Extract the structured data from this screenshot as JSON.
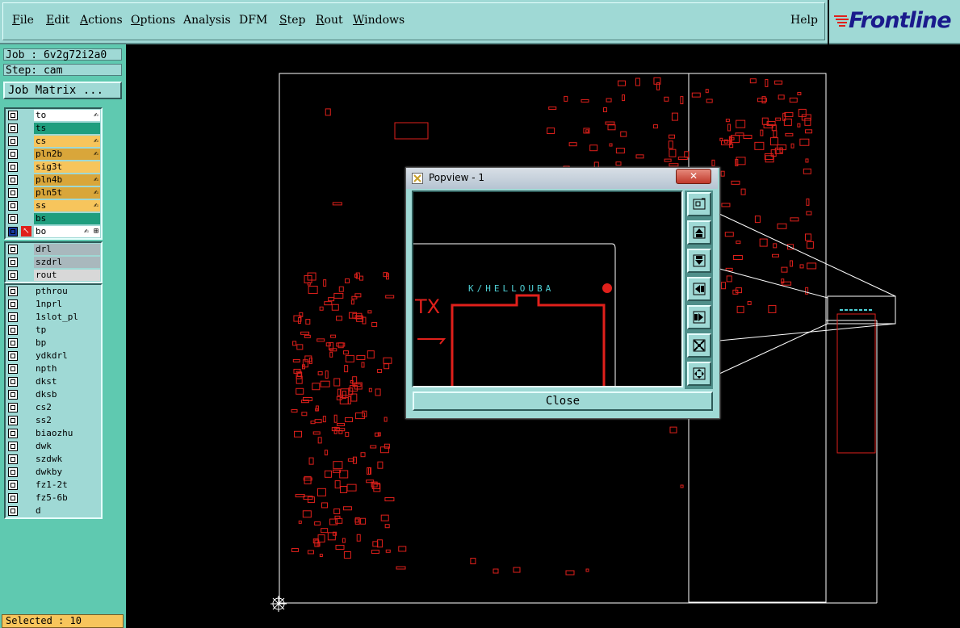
{
  "menu": {
    "items": [
      "File",
      "Edit",
      "Actions",
      "Options",
      "Analysis",
      "DFM",
      "Step",
      "Rout",
      "Windows"
    ],
    "help": "Help"
  },
  "logo": {
    "text": "Frontline"
  },
  "job": {
    "job_label": "Job : 6v2g72i2a0",
    "step_label": "Step: cam"
  },
  "job_matrix_label": "Job Matrix ...",
  "layers_board": [
    {
      "name": "to",
      "color": "#ffffff",
      "ind": "✍"
    },
    {
      "name": "ts",
      "color": "#1f9e7e",
      "ind": ""
    },
    {
      "name": "cs",
      "color": "#f7c55c",
      "ind": "✍"
    },
    {
      "name": "pln2b",
      "color": "#d9a63a",
      "ind": "✍"
    },
    {
      "name": "sig3t",
      "color": "#f7c55c",
      "ind": ""
    },
    {
      "name": "pln4b",
      "color": "#d9a63a",
      "ind": "✍"
    },
    {
      "name": "pln5t",
      "color": "#d9a63a",
      "ind": "✍"
    },
    {
      "name": "ss",
      "color": "#f7c55c",
      "ind": "✍"
    },
    {
      "name": "bs",
      "color": "#1f9e7e",
      "ind": ""
    },
    {
      "name": "bo",
      "color": "#ffffff",
      "ind": "✍ ⊞"
    }
  ],
  "layers_drill": [
    {
      "name": "drl",
      "color": "#a9b8bd"
    },
    {
      "name": "szdrl",
      "color": "#a9b8bd"
    },
    {
      "name": "rout",
      "color": "#d8d8d8"
    }
  ],
  "layers_misc": [
    "pthrou",
    "1nprl",
    "1slot_pl",
    "tp",
    "bp",
    "ydkdrl",
    "npth",
    "dkst",
    "dksb",
    "cs2",
    "ss2",
    "biaozhu",
    "dwk",
    "szdwk",
    "dwkby",
    "fz1-2t",
    "fz5-6b",
    "d"
  ],
  "status": {
    "selected": "Selected : 10"
  },
  "popview": {
    "title": "Popview - 1",
    "close_label": "Close",
    "view_label_tx": "TX",
    "view_silk_text": "K/HELLOUBA"
  },
  "colors": {
    "panel": "#9fd9d5",
    "accent": "#5fc9b0",
    "pcb_red": "#e0201b",
    "cyan_text": "#4fd0d6"
  }
}
